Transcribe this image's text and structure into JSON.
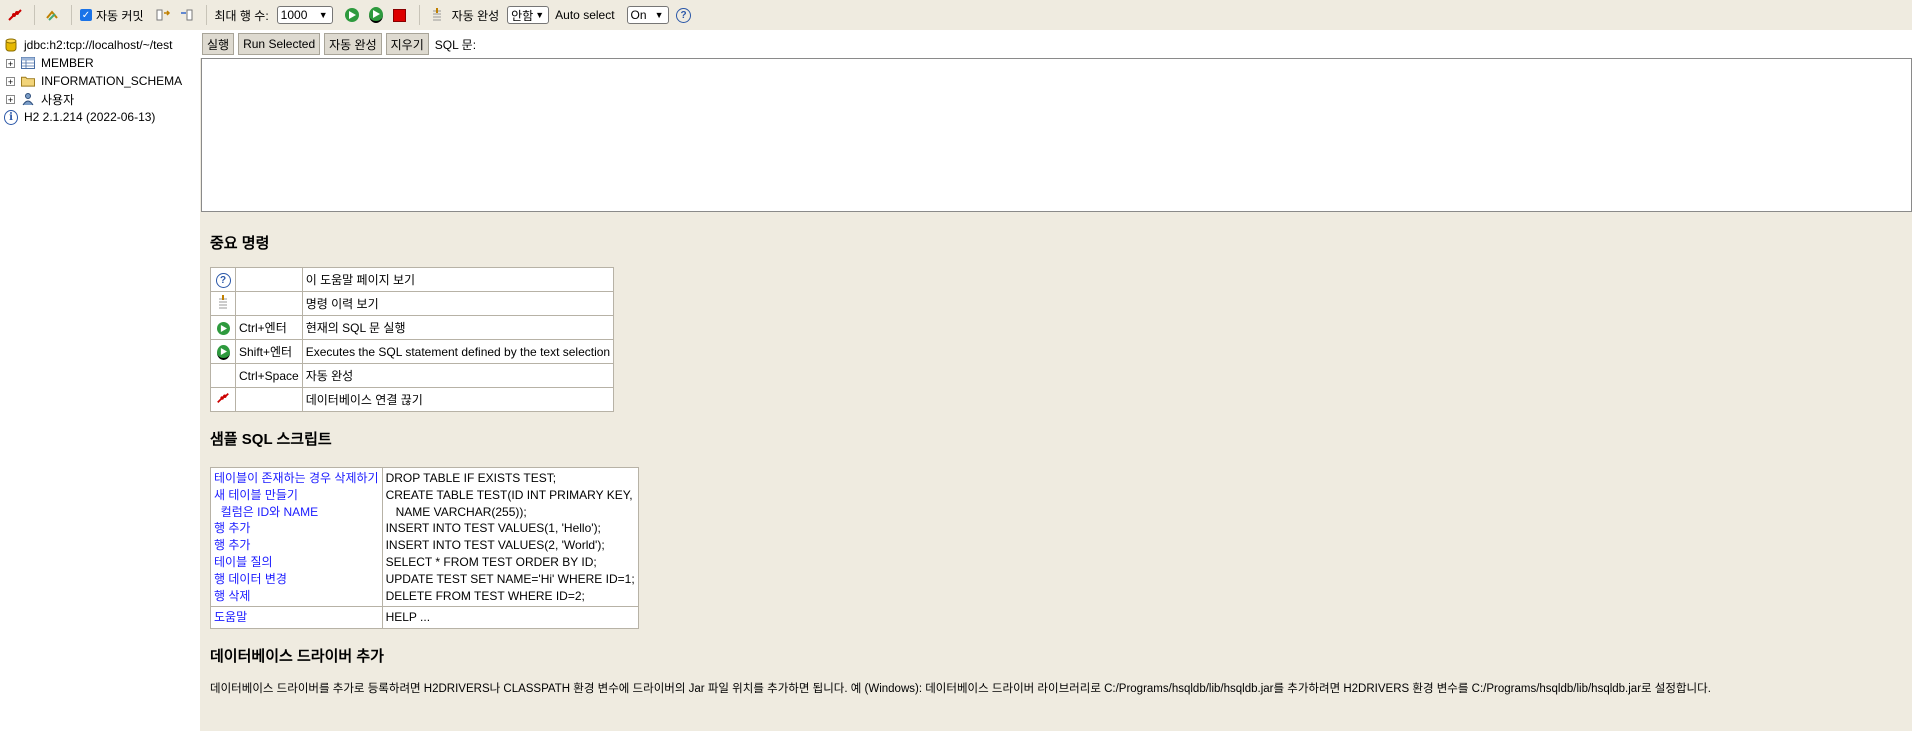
{
  "toolbar": {
    "autocommit_label": "자동 커밋",
    "maxrows_label": "최대 행 수:",
    "maxrows_value": "1000",
    "autocomplete_label": "자동 완성",
    "autocomplete_value": "안함",
    "autoselect_label": "Auto select",
    "autoselect_value": "On"
  },
  "tree": {
    "connection": "jdbc:h2:tcp://localhost/~/test",
    "items": [
      "MEMBER",
      "INFORMATION_SCHEMA",
      "사용자"
    ],
    "version": "H2 2.1.214 (2022-06-13)"
  },
  "query": {
    "run_label": "실행",
    "run_selected_label": "Run Selected",
    "autocomplete_label": "자동 완성",
    "clear_label": "지우기",
    "sql_label": "SQL 문:"
  },
  "help": {
    "important_title": "중요 명령",
    "commands": [
      {
        "icon": "help-icon",
        "key": "",
        "desc": "이 도움말 페이지 보기"
      },
      {
        "icon": "history-icon",
        "key": "",
        "desc": "명령 이력 보기"
      },
      {
        "icon": "run-icon",
        "key": "Ctrl+엔터",
        "desc": "현재의 SQL 문 실행"
      },
      {
        "icon": "run-selected-icon",
        "key": "Shift+엔터",
        "desc": "Executes the SQL statement defined by the text selection"
      },
      {
        "icon": "",
        "key": "Ctrl+Space",
        "desc": "자동 완성"
      },
      {
        "icon": "disconnect-icon",
        "key": "",
        "desc": "데이터베이스 연결 끊기"
      }
    ],
    "sample_title": "샘플 SQL 스크립트",
    "sample_labels": [
      "테이블이 존재하는 경우 삭제하기",
      "새 테이블 만들기",
      "  컬럼은 ID와 NAME",
      "행 추가",
      "행 추가",
      "테이블 질의",
      "행 데이터 변경",
      "행 삭제"
    ],
    "sample_sql": [
      "DROP TABLE IF EXISTS TEST;",
      "CREATE TABLE TEST(ID INT PRIMARY KEY,",
      "   NAME VARCHAR(255));",
      "INSERT INTO TEST VALUES(1, 'Hello');",
      "INSERT INTO TEST VALUES(2, 'World');",
      "SELECT * FROM TEST ORDER BY ID;",
      "UPDATE TEST SET NAME='Hi' WHERE ID=1;",
      "DELETE FROM TEST WHERE ID=2;"
    ],
    "help_label": "도움말",
    "help_sql": "HELP ...",
    "driver_title": "데이터베이스 드라이버 추가",
    "driver_desc": "데이터베이스 드라이버를 추가로 등록하려면 H2DRIVERS나 CLASSPATH 환경 변수에 드라이버의 Jar 파일 위치를 추가하면 됩니다. 예 (Windows): 데이터베이스 드라이버 라이브러리로 C:/Programs/hsqldb/lib/hsqldb.jar를 추가하려면 H2DRIVERS 환경 변수를 C:/Programs/hsqldb/lib/hsqldb.jar로 설정합니다."
  }
}
